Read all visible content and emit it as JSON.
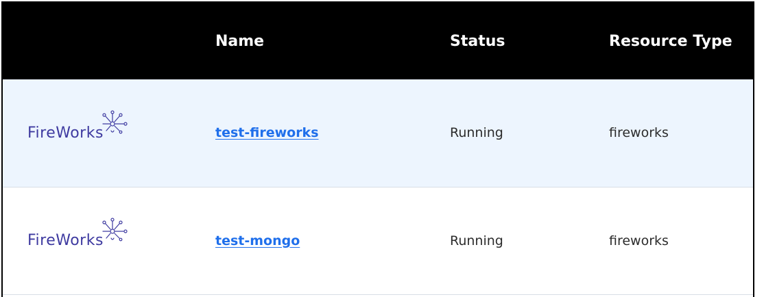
{
  "table": {
    "columns": {
      "logo": "",
      "name": "Name",
      "status": "Status",
      "type": "Resource Type"
    },
    "rows": [
      {
        "logo_text": "FireWorks",
        "name": "test-fireworks",
        "status": "Running",
        "type": "fireworks"
      },
      {
        "logo_text": "FireWorks",
        "name": "test-mongo",
        "status": "Running",
        "type": "fireworks"
      }
    ]
  },
  "icons": {
    "logo": "fireworks-logo-icon"
  },
  "colors": {
    "header_bg": "#000000",
    "header_text": "#ffffff",
    "row_alt_bg": "#edf5fe",
    "link": "#1f6feb",
    "logo": "#3e3aa0"
  }
}
